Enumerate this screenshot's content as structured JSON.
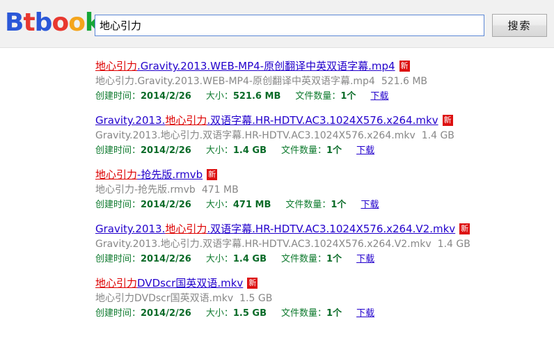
{
  "site": {
    "logo_text": "Btbook",
    "logo_letters": [
      {
        "char": "B",
        "color": "#2b58d8"
      },
      {
        "char": "t",
        "color": "#e8382f"
      },
      {
        "char": "b",
        "color": "#2b58d8"
      },
      {
        "char": "o",
        "color": "#e8382f"
      },
      {
        "char": "o",
        "color": "#f4a51c"
      },
      {
        "char": "k",
        "color": "#16a637"
      }
    ]
  },
  "search": {
    "value": "地心引力",
    "placeholder": "",
    "button_label": "搜索"
  },
  "labels": {
    "created_time": "创建时间：",
    "size": "大小：",
    "file_count": "文件数量：",
    "download": "下载",
    "new_badge": "新"
  },
  "colors": {
    "link": "#2200cc",
    "keyword": "#dd0000",
    "meta": "#0e7a2e",
    "desc": "#878787",
    "badge_bg": "#dd1111",
    "input_border": "#5b87d6"
  },
  "results": [
    {
      "title_parts": [
        {
          "text": "地心引力",
          "kw": true
        },
        {
          "text": ".Gravity.2013.WEB-MP4-原创翻译中英双语字幕.mp4",
          "kw": false
        }
      ],
      "badge": "新",
      "desc": "地心引力.Gravity.2013.WEB-MP4-原创翻译中英双语字幕.mp4",
      "desc_size": "521.6 MB",
      "created": "2014/2/26",
      "size": "521.6 MB",
      "count": "1个",
      "download": "下载"
    },
    {
      "title_parts": [
        {
          "text": "Gravity.2013.",
          "kw": false
        },
        {
          "text": "地心引力",
          "kw": true
        },
        {
          "text": ".双语字幕.HR-HDTV.AC3.1024X576.x264.mkv",
          "kw": false
        }
      ],
      "badge": "新",
      "desc": "Gravity.2013.地心引力.双语字幕.HR-HDTV.AC3.1024X576.x264.mkv",
      "desc_size": "1.4 GB",
      "created": "2014/2/26",
      "size": "1.4 GB",
      "count": "1个",
      "download": "下载"
    },
    {
      "title_parts": [
        {
          "text": "地心引力",
          "kw": true
        },
        {
          "text": "-抢先版.rmvb",
          "kw": false
        }
      ],
      "badge": "新",
      "desc": "地心引力-抢先版.rmvb",
      "desc_size": "471 MB",
      "created": "2014/2/26",
      "size": "471 MB",
      "count": "1个",
      "download": "下载"
    },
    {
      "title_parts": [
        {
          "text": "Gravity.2013.",
          "kw": false
        },
        {
          "text": "地心引力",
          "kw": true
        },
        {
          "text": ".双语字幕.HR-HDTV.AC3.1024X576.x264.V2.mkv",
          "kw": false
        }
      ],
      "badge": "新",
      "desc": "Gravity.2013.地心引力.双语字幕.HR-HDTV.AC3.1024X576.x264.V2.mkv",
      "desc_size": "1.4 GB",
      "created": "2014/2/26",
      "size": "1.4 GB",
      "count": "1个",
      "download": "下载"
    },
    {
      "title_parts": [
        {
          "text": "地心引力",
          "kw": true
        },
        {
          "text": "DVDscr国英双语.mkv",
          "kw": false
        }
      ],
      "badge": "新",
      "desc": "地心引力DVDscr国英双语.mkv",
      "desc_size": "1.5 GB",
      "created": "2014/2/26",
      "size": "1.5 GB",
      "count": "1个",
      "download": "下载"
    }
  ]
}
